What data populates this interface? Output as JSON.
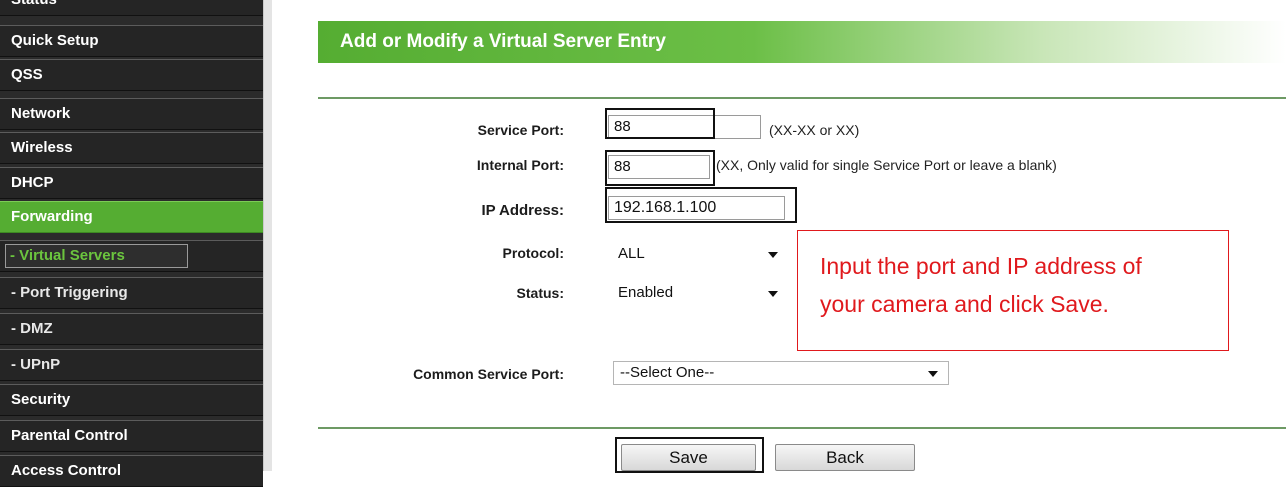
{
  "sidebar": {
    "items": [
      {
        "label": "Status"
      },
      {
        "label": "Quick Setup"
      },
      {
        "label": "QSS"
      },
      {
        "label": "Network"
      },
      {
        "label": "Wireless"
      },
      {
        "label": "DHCP"
      },
      {
        "label": "Forwarding"
      },
      {
        "label": "- Virtual Servers"
      },
      {
        "label": "- Port Triggering"
      },
      {
        "label": "- DMZ"
      },
      {
        "label": "- UPnP"
      },
      {
        "label": "Security"
      },
      {
        "label": "Parental Control"
      },
      {
        "label": "Access Control"
      }
    ]
  },
  "main": {
    "title": "Add or Modify a Virtual Server Entry",
    "service_port": {
      "label": "Service Port:",
      "value": "88",
      "hint": "(XX-XX or XX)"
    },
    "internal_port": {
      "label": "Internal Port:",
      "value": "88",
      "hint": "(XX, Only valid for single Service Port or leave a blank)"
    },
    "ip_address": {
      "label": "IP Address:",
      "value": "192.168.1.100"
    },
    "protocol": {
      "label": "Protocol:",
      "value": "ALL"
    },
    "status": {
      "label": "Status:",
      "value": "Enabled"
    },
    "common_service_port": {
      "label": "Common Service Port:",
      "value": "--Select One--"
    },
    "callout": {
      "line1": "Input the port and IP address of",
      "line2": "your camera and click Save."
    },
    "save_label": "Save",
    "back_label": "Back"
  },
  "colors": {
    "accent": "#55ad32",
    "sidebar_bg": "#252525",
    "callout": "#e0191d"
  }
}
